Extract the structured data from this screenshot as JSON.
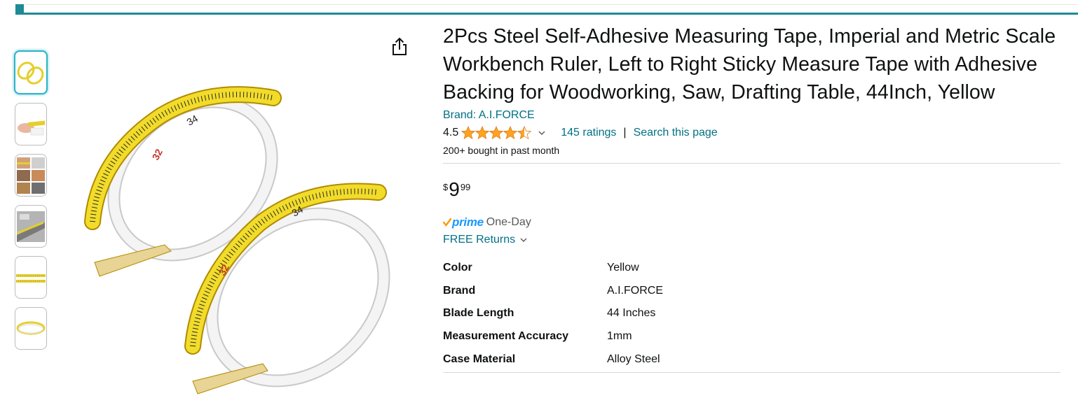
{
  "product": {
    "title": "2Pcs Steel Self-Adhesive Measuring Tape, Imperial and Metric Scale Workbench Ruler, Left to Right Sticky Measure Tape with Adhesive Backing for Woodworking, Saw, Drafting Table, 44Inch, Yellow",
    "brand_link": "Brand: A.I.FORCE",
    "rating_value": "4.5",
    "rating_stars": 4.5,
    "ratings_count_link": "145 ratings",
    "separator": "|",
    "search_link": "Search this page",
    "bought_text": "200+ bought in past month"
  },
  "price": {
    "symbol": "$",
    "whole": "9",
    "fraction": "99"
  },
  "delivery": {
    "prime_logo_text": "prime",
    "prime_label": "One-Day",
    "returns_link": "FREE Returns"
  },
  "specs": [
    {
      "label": "Color",
      "value": "Yellow"
    },
    {
      "label": "Brand",
      "value": "A.I.FORCE"
    },
    {
      "label": "Blade Length",
      "value": "44 Inches"
    },
    {
      "label": "Measurement Accuracy",
      "value": "1mm"
    },
    {
      "label": "Case Material",
      "value": "Alloy Steel"
    }
  ],
  "colors": {
    "link": "#007185",
    "accent_bar": "#1e8a96",
    "star": "#ffa41c",
    "prime_check": "#ff9900",
    "prime_blue": "#1a98ff",
    "tape_yellow": "#f2dc2a"
  },
  "thumbnails": [
    "tape-coils-thumb",
    "hand-holding-tape-thumb",
    "workshop-collage-thumb",
    "table-saw-thumb",
    "tape-strip-thumb",
    "single-coil-thumb"
  ]
}
